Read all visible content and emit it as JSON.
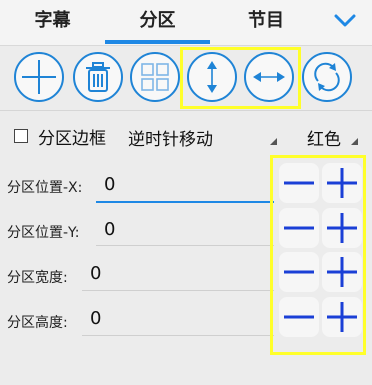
{
  "tabs": [
    {
      "label": "字幕"
    },
    {
      "label": "分区"
    },
    {
      "label": "节目"
    }
  ],
  "active_tab": "分区",
  "accent_color": "#1e88e5",
  "highlight_color": "#ffff2a",
  "toolbar": {
    "icons": [
      "add-icon",
      "trash-icon",
      "grid-icon",
      "vertical-arrows-icon",
      "horizontal-arrows-icon",
      "rotate-icon"
    ]
  },
  "border_option": {
    "label": "分区边框",
    "checked": false,
    "mode_value": "逆时针移动",
    "color_value": "红色"
  },
  "fields": [
    {
      "label": "分区位置-X:",
      "value": "0"
    },
    {
      "label": "分区位置-Y:",
      "value": "0"
    },
    {
      "label": "分区宽度:",
      "value": "0"
    },
    {
      "label": "分区高度:",
      "value": "0"
    }
  ]
}
